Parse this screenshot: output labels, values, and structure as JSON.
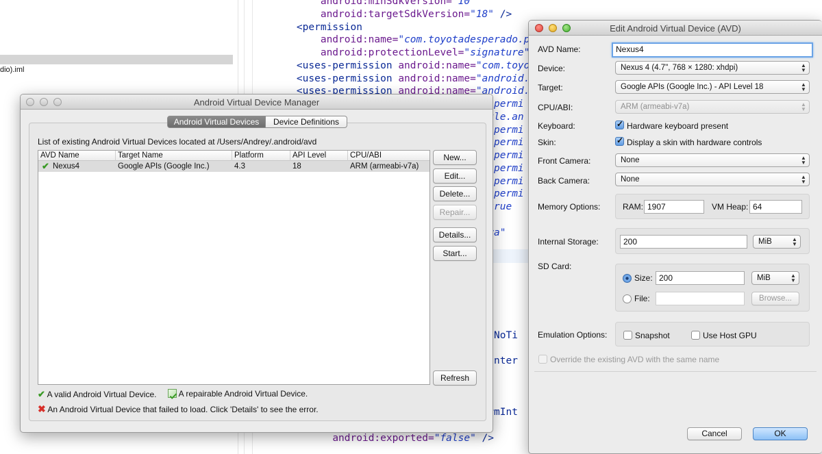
{
  "ide": {
    "project_file": "dio).iml",
    "code_lines": [
      [
        {
          "t": "        ",
          "c": ""
        },
        {
          "t": "android:minSdkVersion=",
          "c": "c-attr"
        },
        {
          "t": "\"10\"",
          "c": "c-val"
        }
      ],
      [
        {
          "t": "        ",
          "c": ""
        },
        {
          "t": "android:targetSdkVersion=",
          "c": "c-attr"
        },
        {
          "t": "\"18\"",
          "c": "c-val"
        },
        {
          "t": " />",
          "c": "c-tag"
        }
      ],
      [
        {
          "t": "    ",
          "c": ""
        },
        {
          "t": "<permission",
          "c": "c-tag"
        }
      ],
      [
        {
          "t": "        ",
          "c": ""
        },
        {
          "t": "android:name=",
          "c": "c-attr"
        },
        {
          "t": "\"com.toyotadesperado.permis",
          "c": "c-val"
        }
      ],
      [
        {
          "t": "        ",
          "c": ""
        },
        {
          "t": "android:protectionLevel=",
          "c": "c-attr"
        },
        {
          "t": "\"signature\"",
          "c": "c-val"
        },
        {
          "t": " />",
          "c": "c-tag"
        }
      ],
      [
        {
          "t": "    ",
          "c": ""
        },
        {
          "t": "<uses-permission ",
          "c": "c-tag"
        },
        {
          "t": "android:name=",
          "c": "c-attr"
        },
        {
          "t": "\"com.toyotades",
          "c": "c-val"
        }
      ],
      [
        {
          "t": "    ",
          "c": ""
        },
        {
          "t": "<uses-permission ",
          "c": "c-tag"
        },
        {
          "t": "android:name=",
          "c": "c-attr"
        },
        {
          "t": "\"android.permi",
          "c": "c-val"
        }
      ],
      [
        {
          "t": "    ",
          "c": ""
        },
        {
          "t": "<uses-permission ",
          "c": "c-tag"
        },
        {
          "t": "android:name=",
          "c": "c-attr"
        },
        {
          "t": "\"android.permi",
          "c": "c-val"
        }
      ],
      [
        {
          "t": "                                   ",
          "c": ""
        },
        {
          "t": "d.permi",
          "c": "c-val"
        }
      ],
      [
        {
          "t": "                                   ",
          "c": ""
        },
        {
          "t": "ogle.an",
          "c": "c-val"
        }
      ],
      [
        {
          "t": "                                   ",
          "c": ""
        },
        {
          "t": "d.permi",
          "c": "c-val"
        }
      ],
      [
        {
          "t": "                                   ",
          "c": ""
        },
        {
          "t": "d.permi",
          "c": "c-val"
        }
      ],
      [
        {
          "t": "                                   ",
          "c": ""
        },
        {
          "t": "d.permi",
          "c": "c-val"
        }
      ],
      [
        {
          "t": "                                   ",
          "c": ""
        },
        {
          "t": "d.permi",
          "c": "c-val"
        }
      ],
      [
        {
          "t": "                                   ",
          "c": ""
        },
        {
          "t": "d.permi",
          "c": "c-val"
        }
      ],
      [
        {
          "t": "                                   ",
          "c": ""
        },
        {
          "t": "d.permi",
          "c": "c-val"
        }
      ],
      [
        {
          "t": "                                 ",
          "c": ""
        },
        {
          "t": "s=",
          "c": "c-attr"
        },
        {
          "t": "\"true",
          "c": "c-val"
        }
      ],
      [],
      [
        {
          "t": "                                  ",
          "c": ""
        },
        {
          "t": "mera\"",
          "c": "c-val"
        }
      ],
      [],
      [],
      [],
      [],
      [],
      [],
      [],
      [
        {
          "t": "                                  ",
          "c": ""
        },
        {
          "t": "me.NoTi",
          "c": "c-tag"
        }
      ],
      [],
      [
        {
          "t": "                                  ",
          "c": ""
        },
        {
          "t": "ceInter",
          "c": "c-tag"
        }
      ],
      [],
      [],
      [],
      [
        {
          "t": "                                  ",
          "c": ""
        },
        {
          "t": "larmInt",
          "c": "c-tag"
        }
      ],
      [
        {
          "t": "          ",
          "c": ""
        },
        {
          "t": "android:enabled=",
          "c": "c-attr"
        },
        {
          "t": "\"true\"",
          "c": "c-val"
        }
      ],
      [
        {
          "t": "          ",
          "c": ""
        },
        {
          "t": "android:exported=",
          "c": "c-attr"
        },
        {
          "t": "\"false\"",
          "c": "c-val"
        },
        {
          "t": " />",
          "c": "c-tag"
        }
      ]
    ]
  },
  "avd_manager": {
    "title": "Android Virtual Device Manager",
    "tabs": [
      "Android Virtual Devices",
      "Device Definitions"
    ],
    "list_label": "List of existing Android Virtual Devices located at /Users/Andrey/.android/avd",
    "columns": [
      "AVD Name",
      "Target Name",
      "Platform",
      "API Level",
      "CPU/ABI"
    ],
    "rows": [
      {
        "name": "Nexus4",
        "target": "Google APIs (Google Inc.)",
        "platform": "4.3",
        "api": "18",
        "cpu": "ARM (armeabi-v7a)"
      }
    ],
    "buttons": {
      "new": "New...",
      "edit": "Edit...",
      "delete": "Delete...",
      "repair": "Repair...",
      "details": "Details...",
      "start": "Start...",
      "refresh": "Refresh"
    },
    "legend": {
      "valid": "A valid Android Virtual Device.",
      "repairable": "A repairable Android Virtual Device.",
      "failed": "An Android Virtual Device that failed to load. Click 'Details' to see the error."
    }
  },
  "edit_avd": {
    "title": "Edit Android Virtual Device (AVD)",
    "labels": {
      "avd_name": "AVD Name:",
      "device": "Device:",
      "target": "Target:",
      "cpu": "CPU/ABI:",
      "keyboard": "Keyboard:",
      "skin": "Skin:",
      "front_camera": "Front Camera:",
      "back_camera": "Back Camera:",
      "memory": "Memory Options:",
      "ram": "RAM:",
      "vm_heap": "VM Heap:",
      "internal": "Internal Storage:",
      "sd_card": "SD Card:",
      "size": "Size:",
      "file": "File:",
      "emulation": "Emulation Options:"
    },
    "values": {
      "avd_name": "Nexus4",
      "device": "Nexus 4 (4.7\", 768 × 1280: xhdpi)",
      "target": "Google APIs (Google Inc.) - API Level 18",
      "cpu": "ARM (armeabi-v7a)",
      "keyboard_text": "Hardware keyboard present",
      "skin_text": "Display a skin with hardware controls",
      "front_camera": "None",
      "back_camera": "None",
      "ram": "1907",
      "vm_heap": "64",
      "internal": "200",
      "internal_unit": "MiB",
      "sd_size": "200",
      "sd_unit": "MiB",
      "sd_file": "",
      "browse": "Browse...",
      "snapshot": "Snapshot",
      "host_gpu": "Use Host GPU",
      "override": "Override the existing AVD with the same name"
    },
    "buttons": {
      "cancel": "Cancel",
      "ok": "OK"
    }
  }
}
